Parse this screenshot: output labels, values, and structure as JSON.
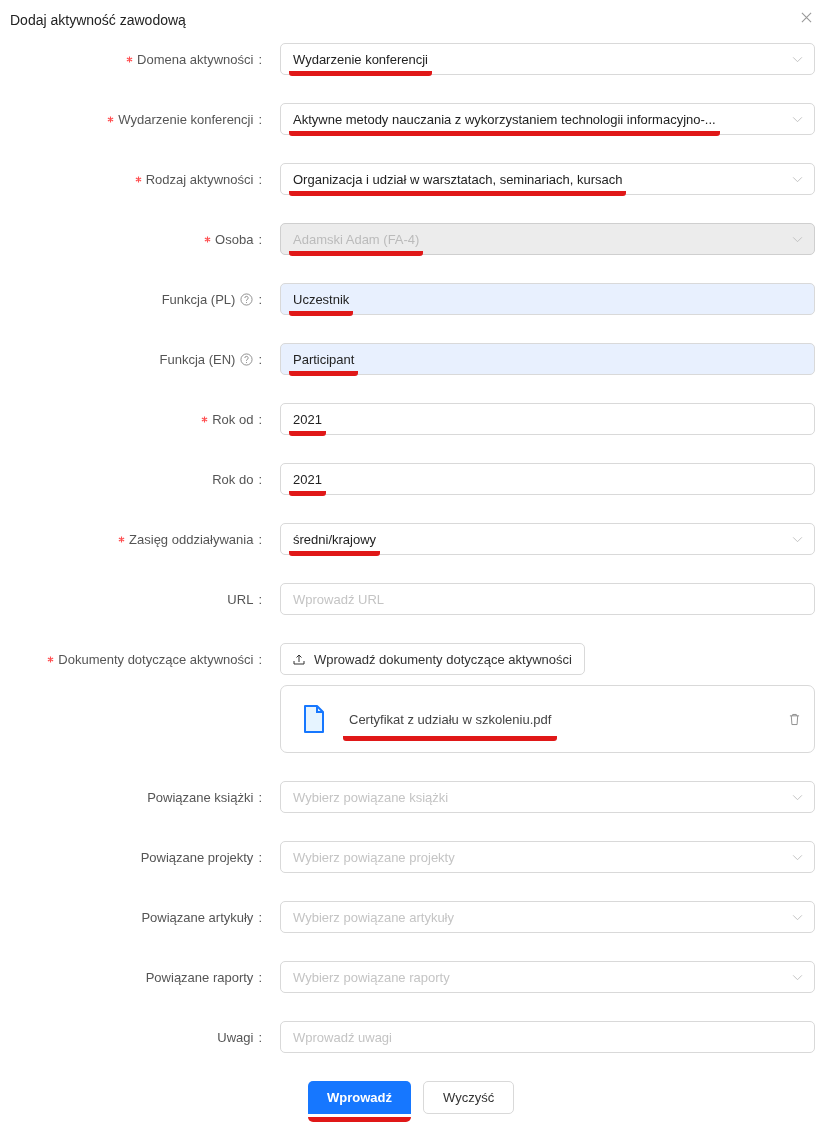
{
  "dialog": {
    "title": "Dodaj aktywność zawodową"
  },
  "fields": [
    {
      "label": "Domena aktywności",
      "suffix": ":",
      "required": true,
      "help": false,
      "kind": "select",
      "value": "Wydarzenie konferencji",
      "disabled": false,
      "autofilled": false,
      "annotated": true
    },
    {
      "label": "Wydarzenie konferencji",
      "suffix": ":",
      "required": true,
      "help": false,
      "kind": "select",
      "value": "Aktywne metody nauczania z wykorzystaniem technologii informacyjno-...",
      "disabled": false,
      "autofilled": false,
      "annotated": true
    },
    {
      "label": "Rodzaj aktywności",
      "suffix": ":",
      "required": true,
      "help": false,
      "kind": "select",
      "value": "Organizacja i udział w warsztatach, seminariach, kursach",
      "disabled": false,
      "autofilled": false,
      "annotated": true
    },
    {
      "label": "Osoba",
      "suffix": ":",
      "required": true,
      "help": false,
      "kind": "select",
      "value": "Adamski Adam (FA-4)",
      "disabled": true,
      "autofilled": false,
      "annotated": true
    },
    {
      "label": "Funkcja (PL)",
      "suffix": ":",
      "required": false,
      "help": true,
      "kind": "input",
      "value": "Uczestnik",
      "disabled": false,
      "autofilled": true,
      "annotated": true
    },
    {
      "label": "Funkcja (EN)",
      "suffix": ":",
      "required": false,
      "help": true,
      "kind": "input",
      "value": "Participant",
      "disabled": false,
      "autofilled": true,
      "annotated": true
    },
    {
      "label": "Rok od",
      "suffix": ":",
      "required": true,
      "help": false,
      "kind": "input",
      "value": "2021",
      "disabled": false,
      "autofilled": false,
      "annotated": true
    },
    {
      "label": "Rok do",
      "suffix": ":",
      "required": false,
      "help": false,
      "kind": "input",
      "value": "2021",
      "disabled": false,
      "autofilled": false,
      "annotated": true
    },
    {
      "label": "Zasięg oddziaływania",
      "suffix": ":",
      "required": true,
      "help": false,
      "kind": "select",
      "value": "średni/krajowy",
      "disabled": false,
      "autofilled": false,
      "annotated": true
    },
    {
      "label": "URL",
      "suffix": ":",
      "required": false,
      "help": false,
      "kind": "input",
      "placeholder": "Wprowadź URL",
      "disabled": false,
      "autofilled": false,
      "annotated": false
    },
    {
      "label": "Dokumenty dotyczące aktywności",
      "suffix": ":",
      "required": true,
      "help": false,
      "kind": "upload",
      "button": "Wprowadź dokumenty dotyczące aktywności",
      "files": [
        {
          "name": "Certyfikat z udziału w szkoleniu.pdf",
          "annotated": true
        }
      ]
    },
    {
      "label": "Powiązane książki",
      "suffix": ":",
      "required": false,
      "help": false,
      "kind": "select",
      "placeholder": "Wybierz powiązane książki",
      "disabled": false,
      "autofilled": false,
      "annotated": false
    },
    {
      "label": "Powiązane projekty",
      "suffix": ":",
      "required": false,
      "help": false,
      "kind": "select",
      "placeholder": "Wybierz powiązane projekty",
      "disabled": false,
      "autofilled": false,
      "annotated": false
    },
    {
      "label": "Powiązane artykuły",
      "suffix": ":",
      "required": false,
      "help": false,
      "kind": "select",
      "placeholder": "Wybierz powiązane artykuły",
      "disabled": false,
      "autofilled": false,
      "annotated": false
    },
    {
      "label": "Powiązane raporty",
      "suffix": ":",
      "required": false,
      "help": false,
      "kind": "select",
      "placeholder": "Wybierz powiązane raporty",
      "disabled": false,
      "autofilled": false,
      "annotated": false
    },
    {
      "label": "Uwagi",
      "suffix": ":",
      "required": false,
      "help": false,
      "kind": "input",
      "placeholder": "Wprowadź uwagi",
      "disabled": false,
      "autofilled": false,
      "annotated": false
    }
  ],
  "buttons": [
    {
      "label": "Wprowadź",
      "kind": "primary",
      "annotated": true
    },
    {
      "label": "Wyczyść",
      "kind": "default",
      "annotated": false
    }
  ]
}
